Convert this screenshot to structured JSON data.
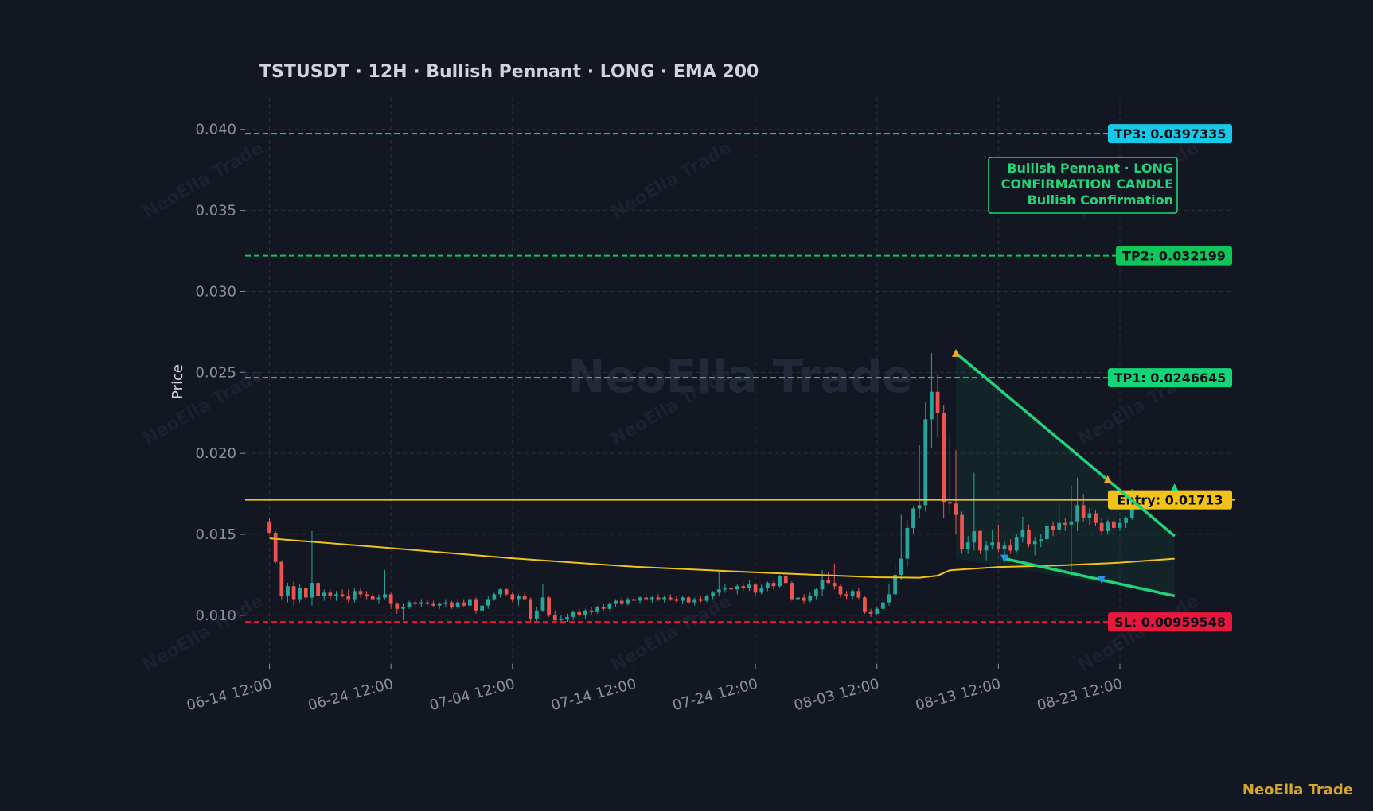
{
  "chart_data": {
    "type": "candlestick",
    "title": "TSTUSDT  ·  12H  ·  Bullish Pennant  ·  LONG  ·  EMA 200",
    "ylabel": "Price",
    "ylim": [
      0.007,
      0.042
    ],
    "y_ticks": [
      "0.010",
      "0.015",
      "0.020",
      "0.025",
      "0.030",
      "0.035",
      "0.040"
    ],
    "y_tick_values": [
      0.01,
      0.015,
      0.02,
      0.025,
      0.03,
      0.035,
      0.04
    ],
    "x_ticks": [
      "06-14 12:00",
      "06-24 12:00",
      "07-04 12:00",
      "07-14 12:00",
      "07-24 12:00",
      "08-03 12:00",
      "08-13 12:00",
      "08-23 12:00"
    ],
    "x_tick_index": [
      0,
      20,
      40,
      60,
      80,
      100,
      120,
      140
    ],
    "x_range": [
      -4,
      159
    ],
    "candles": [
      [
        0.0158,
        0.016,
        0.015,
        0.0151
      ],
      [
        0.0151,
        0.0152,
        0.0132,
        0.0133
      ],
      [
        0.0133,
        0.0134,
        0.011,
        0.0112
      ],
      [
        0.0112,
        0.012,
        0.0108,
        0.0118
      ],
      [
        0.0118,
        0.0121,
        0.0106,
        0.011
      ],
      [
        0.011,
        0.0119,
        0.0108,
        0.0117
      ],
      [
        0.0117,
        0.0118,
        0.0109,
        0.0111
      ],
      [
        0.0111,
        0.0152,
        0.0106,
        0.012
      ],
      [
        0.012,
        0.0121,
        0.0106,
        0.0112
      ],
      [
        0.0112,
        0.0116,
        0.0109,
        0.0114
      ],
      [
        0.0114,
        0.0116,
        0.011,
        0.0112
      ],
      [
        0.0112,
        0.0115,
        0.0109,
        0.0113
      ],
      [
        0.0113,
        0.0116,
        0.0111,
        0.0112
      ],
      [
        0.0112,
        0.0116,
        0.0108,
        0.011
      ],
      [
        0.011,
        0.0117,
        0.0108,
        0.0115
      ],
      [
        0.0115,
        0.0117,
        0.0111,
        0.0113
      ],
      [
        0.0113,
        0.0115,
        0.011,
        0.0112
      ],
      [
        0.0112,
        0.0114,
        0.0109,
        0.011
      ],
      [
        0.011,
        0.0113,
        0.0107,
        0.0111
      ],
      [
        0.0111,
        0.0128,
        0.011,
        0.0113
      ],
      [
        0.0113,
        0.0114,
        0.0104,
        0.0107
      ],
      [
        0.0107,
        0.0108,
        0.0101,
        0.0104
      ],
      [
        0.0104,
        0.0107,
        0.0097,
        0.0105
      ],
      [
        0.0105,
        0.0109,
        0.0104,
        0.0108
      ],
      [
        0.0108,
        0.011,
        0.0105,
        0.0107
      ],
      [
        0.0107,
        0.011,
        0.0105,
        0.0108
      ],
      [
        0.0108,
        0.011,
        0.0106,
        0.0107
      ],
      [
        0.0107,
        0.0109,
        0.0105,
        0.0106
      ],
      [
        0.0106,
        0.0108,
        0.0104,
        0.0107
      ],
      [
        0.0107,
        0.011,
        0.0105,
        0.0108
      ],
      [
        0.0108,
        0.0109,
        0.0104,
        0.0105
      ],
      [
        0.0105,
        0.011,
        0.0104,
        0.0108
      ],
      [
        0.0108,
        0.011,
        0.0105,
        0.0106
      ],
      [
        0.0106,
        0.0112,
        0.0104,
        0.011
      ],
      [
        0.011,
        0.0111,
        0.0101,
        0.0103
      ],
      [
        0.0103,
        0.0107,
        0.0102,
        0.0106
      ],
      [
        0.0106,
        0.0112,
        0.0104,
        0.011
      ],
      [
        0.011,
        0.0114,
        0.0109,
        0.0113
      ],
      [
        0.0113,
        0.0117,
        0.0111,
        0.0116
      ],
      [
        0.0116,
        0.0117,
        0.0112,
        0.0113
      ],
      [
        0.0113,
        0.0114,
        0.0108,
        0.011
      ],
      [
        0.011,
        0.0113,
        0.0106,
        0.0112
      ],
      [
        0.0112,
        0.0114,
        0.0109,
        0.011
      ],
      [
        0.011,
        0.0111,
        0.0096,
        0.0098
      ],
      [
        0.0098,
        0.0105,
        0.0096,
        0.0103
      ],
      [
        0.0103,
        0.0119,
        0.0102,
        0.0111
      ],
      [
        0.0111,
        0.0112,
        0.0099,
        0.01
      ],
      [
        0.01,
        0.0103,
        0.0096,
        0.0097
      ],
      [
        0.0097,
        0.01,
        0.0095,
        0.0098
      ],
      [
        0.0098,
        0.0101,
        0.0096,
        0.0099
      ],
      [
        0.0099,
        0.0103,
        0.0097,
        0.0102
      ],
      [
        0.0102,
        0.0104,
        0.0099,
        0.01
      ],
      [
        0.01,
        0.0104,
        0.0098,
        0.0103
      ],
      [
        0.0103,
        0.0105,
        0.01,
        0.0102
      ],
      [
        0.0102,
        0.0106,
        0.0101,
        0.0105
      ],
      [
        0.0105,
        0.0107,
        0.0103,
        0.0104
      ],
      [
        0.0104,
        0.0108,
        0.0103,
        0.0107
      ],
      [
        0.0107,
        0.011,
        0.0105,
        0.0109
      ],
      [
        0.0109,
        0.0111,
        0.0106,
        0.0107
      ],
      [
        0.0107,
        0.0111,
        0.0106,
        0.011
      ],
      [
        0.011,
        0.0112,
        0.0108,
        0.0109
      ],
      [
        0.0109,
        0.0112,
        0.0107,
        0.0111
      ],
      [
        0.0111,
        0.0113,
        0.0109,
        0.011
      ],
      [
        0.011,
        0.0112,
        0.0108,
        0.0111
      ],
      [
        0.0111,
        0.0113,
        0.0109,
        0.011
      ],
      [
        0.011,
        0.0112,
        0.0108,
        0.0111
      ],
      [
        0.0111,
        0.0113,
        0.0109,
        0.011
      ],
      [
        0.011,
        0.0112,
        0.0108,
        0.0109
      ],
      [
        0.0109,
        0.0112,
        0.0107,
        0.0111
      ],
      [
        0.0111,
        0.0112,
        0.0107,
        0.0108
      ],
      [
        0.0108,
        0.0111,
        0.0106,
        0.011
      ],
      [
        0.011,
        0.0112,
        0.0108,
        0.0109
      ],
      [
        0.0109,
        0.0113,
        0.0108,
        0.0112
      ],
      [
        0.0112,
        0.0115,
        0.011,
        0.0114
      ],
      [
        0.0114,
        0.0127,
        0.0112,
        0.0116
      ],
      [
        0.0116,
        0.0119,
        0.0114,
        0.0117
      ],
      [
        0.0117,
        0.012,
        0.0114,
        0.0116
      ],
      [
        0.0116,
        0.0119,
        0.0113,
        0.0118
      ],
      [
        0.0118,
        0.012,
        0.0115,
        0.0117
      ],
      [
        0.0117,
        0.0122,
        0.0115,
        0.0119
      ],
      [
        0.0119,
        0.012,
        0.0112,
        0.0114
      ],
      [
        0.0114,
        0.0119,
        0.0113,
        0.0117
      ],
      [
        0.0117,
        0.0121,
        0.0115,
        0.012
      ],
      [
        0.012,
        0.0122,
        0.0116,
        0.0118
      ],
      [
        0.0118,
        0.0125,
        0.0117,
        0.0124
      ],
      [
        0.0124,
        0.0125,
        0.0119,
        0.012
      ],
      [
        0.012,
        0.0121,
        0.0109,
        0.011
      ],
      [
        0.011,
        0.0113,
        0.0108,
        0.0111
      ],
      [
        0.0111,
        0.0113,
        0.0107,
        0.0109
      ],
      [
        0.0109,
        0.0114,
        0.0108,
        0.0112
      ],
      [
        0.0112,
        0.0117,
        0.011,
        0.0116
      ],
      [
        0.0116,
        0.0128,
        0.0112,
        0.0122
      ],
      [
        0.0122,
        0.0127,
        0.0119,
        0.012
      ],
      [
        0.012,
        0.0132,
        0.0116,
        0.0118
      ],
      [
        0.0118,
        0.0119,
        0.0111,
        0.0113
      ],
      [
        0.0113,
        0.0115,
        0.011,
        0.0112
      ],
      [
        0.0112,
        0.0116,
        0.011,
        0.0115
      ],
      [
        0.0115,
        0.0117,
        0.011,
        0.0111
      ],
      [
        0.0111,
        0.0112,
        0.0101,
        0.0102
      ],
      [
        0.0102,
        0.0104,
        0.0099,
        0.0101
      ],
      [
        0.0101,
        0.0105,
        0.01,
        0.0104
      ],
      [
        0.0104,
        0.0109,
        0.0103,
        0.0108
      ],
      [
        0.0108,
        0.0119,
        0.0106,
        0.0113
      ],
      [
        0.0113,
        0.0132,
        0.0111,
        0.0125
      ],
      [
        0.0125,
        0.0162,
        0.0122,
        0.0135
      ],
      [
        0.0135,
        0.0159,
        0.013,
        0.0154
      ],
      [
        0.0154,
        0.0167,
        0.015,
        0.0166
      ],
      [
        0.0166,
        0.0205,
        0.016,
        0.0168
      ],
      [
        0.0168,
        0.0232,
        0.0164,
        0.0221
      ],
      [
        0.0221,
        0.0262,
        0.0203,
        0.0238
      ],
      [
        0.0238,
        0.0249,
        0.021,
        0.0225
      ],
      [
        0.0225,
        0.023,
        0.016,
        0.017
      ],
      [
        0.017,
        0.0212,
        0.0163,
        0.0169
      ],
      [
        0.0169,
        0.0202,
        0.015,
        0.0162
      ],
      [
        0.0162,
        0.0164,
        0.0138,
        0.0141
      ],
      [
        0.0141,
        0.0149,
        0.0138,
        0.0145
      ],
      [
        0.0145,
        0.0188,
        0.014,
        0.0152
      ],
      [
        0.0152,
        0.0153,
        0.0138,
        0.014
      ],
      [
        0.014,
        0.0146,
        0.0134,
        0.0143
      ],
      [
        0.0143,
        0.0153,
        0.0141,
        0.0145
      ],
      [
        0.0145,
        0.0156,
        0.0139,
        0.0141
      ],
      [
        0.0141,
        0.0146,
        0.0137,
        0.0143
      ],
      [
        0.0143,
        0.0147,
        0.0138,
        0.014
      ],
      [
        0.014,
        0.015,
        0.0139,
        0.0148
      ],
      [
        0.0148,
        0.0161,
        0.0145,
        0.0153
      ],
      [
        0.0153,
        0.0156,
        0.0142,
        0.0144
      ],
      [
        0.0144,
        0.0148,
        0.0137,
        0.0146
      ],
      [
        0.0146,
        0.015,
        0.0142,
        0.0147
      ],
      [
        0.0147,
        0.0158,
        0.0145,
        0.0155
      ],
      [
        0.0155,
        0.0158,
        0.0149,
        0.0153
      ],
      [
        0.0153,
        0.0169,
        0.015,
        0.0157
      ],
      [
        0.0157,
        0.016,
        0.0152,
        0.0156
      ],
      [
        0.0156,
        0.018,
        0.0124,
        0.0158
      ],
      [
        0.0158,
        0.0185,
        0.0152,
        0.0168
      ],
      [
        0.0168,
        0.0175,
        0.0158,
        0.016
      ],
      [
        0.016,
        0.0166,
        0.0156,
        0.0163
      ],
      [
        0.0163,
        0.0165,
        0.0155,
        0.0157
      ],
      [
        0.0157,
        0.016,
        0.015,
        0.0152
      ],
      [
        0.0152,
        0.0159,
        0.015,
        0.0158
      ],
      [
        0.0158,
        0.016,
        0.015,
        0.0154
      ],
      [
        0.0154,
        0.016,
        0.0152,
        0.0157
      ],
      [
        0.0157,
        0.0161,
        0.0154,
        0.016
      ],
      [
        0.016,
        0.0178,
        0.0159,
        0.017
      ]
    ],
    "ema": {
      "name": "EMA 200",
      "color": "#f0c21a",
      "x": [
        0,
        20,
        40,
        60,
        80,
        90,
        100,
        107,
        110,
        112,
        120,
        130,
        140,
        149
      ],
      "y": [
        0.01475,
        0.01415,
        0.01352,
        0.013,
        0.01265,
        0.0125,
        0.01235,
        0.01232,
        0.01245,
        0.01278,
        0.01298,
        0.01308,
        0.01325,
        0.0135
      ]
    },
    "levels": [
      {
        "name": "TP3",
        "label": "TP3: 0.0397335",
        "value": 0.0397335,
        "color": "#17c9e6",
        "style": "dashed"
      },
      {
        "name": "TP2",
        "label": "TP2: 0.032199",
        "value": 0.032199,
        "color": "#0ec65a",
        "style": "dashed"
      },
      {
        "name": "TP1",
        "label": "TP1: 0.0246645",
        "value": 0.0246645,
        "color": "#14d477",
        "style": "dashed"
      },
      {
        "name": "Entry",
        "label": "Entry: 0.01713",
        "value": 0.01713,
        "color": "#f0c21a",
        "style": "solid"
      },
      {
        "name": "SL",
        "label": "SL: 0.00959548",
        "value": 0.00959548,
        "color": "#e8173e",
        "style": "dashed"
      }
    ],
    "pattern": {
      "upper": {
        "x": [
          113,
          149
        ],
        "y": [
          0.0262,
          0.0149
        ]
      },
      "lower": {
        "x": [
          121,
          149
        ],
        "y": [
          0.0135,
          0.0112
        ]
      },
      "markers": [
        {
          "dir": "up",
          "x": 113,
          "y": 0.0262,
          "color": "#f5a623"
        },
        {
          "dir": "up",
          "x": 138,
          "y": 0.0184,
          "color": "#f5a623"
        },
        {
          "dir": "down",
          "x": 121,
          "y": 0.0135,
          "color": "#2d8ef0"
        },
        {
          "dir": "down",
          "x": 137,
          "y": 0.0122,
          "color": "#2d8ef0"
        },
        {
          "dir": "up",
          "x": 149,
          "y": 0.0179,
          "color": "#1fd47a"
        }
      ],
      "color": "#1fd47a"
    },
    "annotation": [
      "Bullish Pennant · LONG",
      "CONFIRMATION CANDLE",
      "Bullish Confirmation"
    ],
    "watermark": "NeoElla Trade",
    "colors": {
      "up": "#26a69a",
      "down": "#ef5350",
      "bg": "#131722",
      "grid": "#2a2f3d"
    }
  },
  "brand": "NeoElla Trade"
}
